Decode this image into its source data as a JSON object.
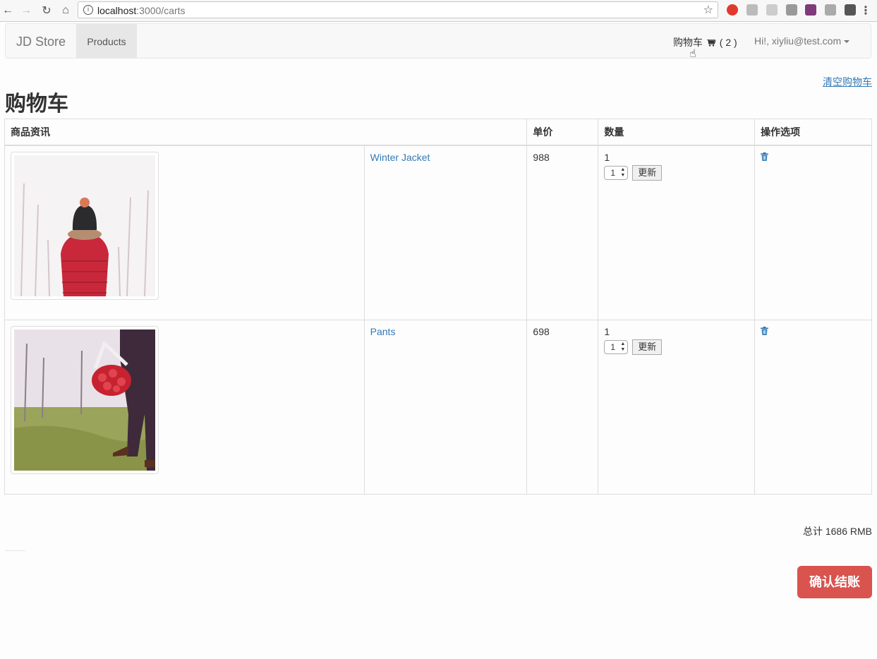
{
  "browser": {
    "url_host": "localhost",
    "url_path": ":3000/carts"
  },
  "navbar": {
    "brand": "JD Store",
    "products": "Products",
    "cart_label": "购物车",
    "cart_count": "( 2 )",
    "user": "Hi!, xiyliu@test.com"
  },
  "page": {
    "clear_cart": "清空购物车",
    "title": "购物车"
  },
  "table": {
    "headers": [
      "商品资讯",
      "单价",
      "数量",
      "操作选项"
    ],
    "rows": [
      {
        "name": "Winter Jacket",
        "price": "988",
        "quantity": "1",
        "select_value": "1",
        "update_label": "更新"
      },
      {
        "name": "Pants",
        "price": "698",
        "quantity": "1",
        "select_value": "1",
        "update_label": "更新"
      }
    ]
  },
  "summary": {
    "total": "总计 1686 RMB",
    "checkout": "确认结账"
  },
  "colors": {
    "link": "#337ab7",
    "checkout": "#d9534f"
  },
  "icons": [
    "back-icon",
    "forward-icon",
    "reload-icon",
    "home-icon",
    "info-icon",
    "star-icon",
    "cart-icon",
    "trash-icon",
    "pointer-icon"
  ]
}
